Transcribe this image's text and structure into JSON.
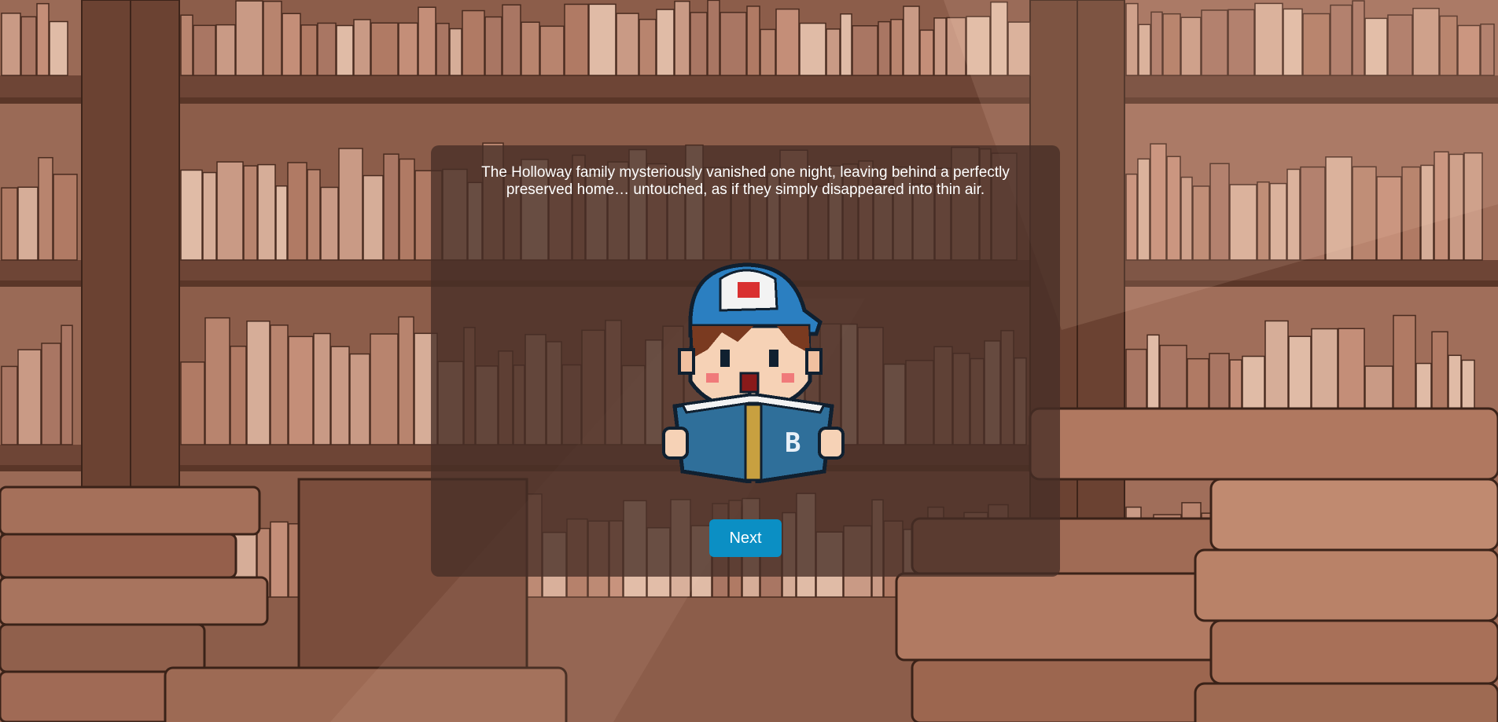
{
  "dialog": {
    "narration": "The Holloway family mysteriously vanished one night, leaving behind a perfectly preserved home… untouched, as if they simply disappeared into thin air.",
    "next_label": "Next"
  },
  "colors": {
    "accent": "#0b8fc4",
    "overlay": "#462e26",
    "background_wood": "#8a5a48"
  },
  "icons": {
    "avatar": "boy-reading-book-icon"
  }
}
